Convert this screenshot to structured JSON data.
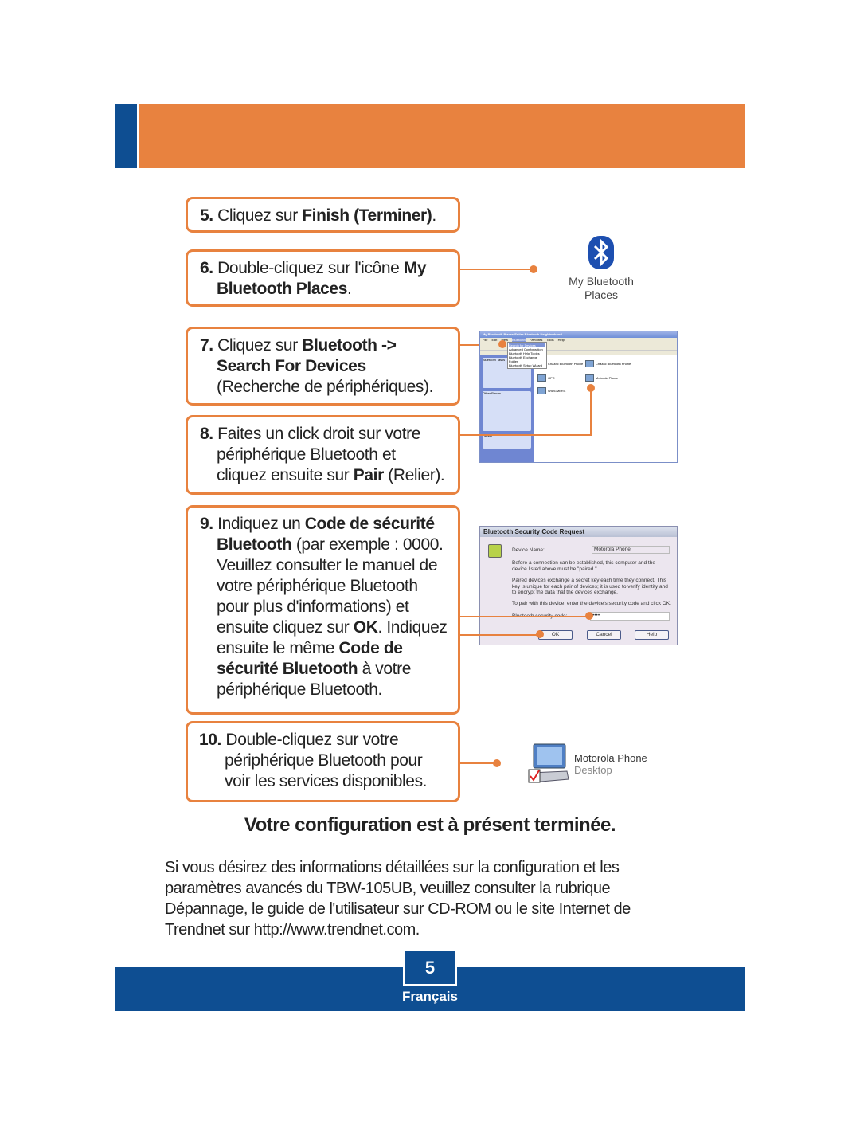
{
  "colors": {
    "accent": "#E8823F",
    "brand": "#0E4E92"
  },
  "steps": [
    {
      "num": "5.",
      "segments": [
        {
          "t": " Cliquez sur "
        },
        {
          "t": "Finish (Terminer)",
          "b": true
        },
        {
          "t": "."
        }
      ]
    },
    {
      "num": "6.",
      "segments": [
        {
          "t": " Double-cliquez sur l'icône "
        },
        {
          "t": "My Bluetooth Places",
          "b": true
        },
        {
          "t": "."
        }
      ]
    },
    {
      "num": "7.",
      "segments": [
        {
          "t": " Cliquez sur "
        },
        {
          "t": "Bluetooth -> Search For Devices",
          "b": true
        },
        {
          "t": " (Recherche de périphériques)."
        }
      ]
    },
    {
      "num": "8.",
      "segments": [
        {
          "t": " Faites un click droit sur votre périphérique Bluetooth et cliquez ensuite sur "
        },
        {
          "t": "Pair",
          "b": true
        },
        {
          "t": " (Relier)."
        }
      ]
    },
    {
      "num": "9.",
      "segments": [
        {
          "t": " Indiquez un "
        },
        {
          "t": "Code de sécurité Bluetooth",
          "b": true
        },
        {
          "t": " (par exemple : 0000. Veuillez consulter le manuel de votre périphérique Bluetooth pour plus d'informations) et ensuite cliquez sur "
        },
        {
          "t": "OK",
          "b": true
        },
        {
          "t": ". Indiquez ensuite le même "
        },
        {
          "t": "Code de sécurité Bluetooth",
          "b": true
        },
        {
          "t": " à votre périphérique Bluetooth."
        }
      ]
    },
    {
      "num": "10.",
      "segments": [
        {
          "t": " Double-cliquez sur votre périphérique Bluetooth pour voir les services disponibles."
        }
      ]
    }
  ],
  "bluetooth_icon": {
    "icon": "bluetooth-icon",
    "label": "My Bluetooth Places"
  },
  "explorer": {
    "title": "My Bluetooth Places\\Entire Bluetooth Neighborhood",
    "menu": [
      "File",
      "Edit",
      "View",
      "Bluetooth",
      "Favorites",
      "Tools",
      "Help"
    ],
    "dropdown": [
      "Search for Devices",
      "Advanced Configuration",
      "Bluetooth Help Topics",
      "Bluetooth Exchange Folder",
      "Bluetooth Setup Wizard"
    ],
    "devices": [
      "Chaz8c Bluetooth Phone",
      "Chaz8c Bluetooth Phone",
      "GPC",
      "Motorola Phone",
      "WIDGMERX"
    ],
    "side_panels": [
      "Bluetooth Tasks",
      "Other Places",
      "Details"
    ]
  },
  "dialog": {
    "title": "Bluetooth Security Code Request",
    "device_name_label": "Device Name:",
    "device_name": "Motorola Phone",
    "p1": "Before a connection can be established, this computer and the device listed above must be \"paired.\"",
    "p2": "Paired devices exchange a secret key each time they connect. This key is unique for each pair of devices; it is used to verify identity and to encrypt the data that the devices exchange.",
    "p3": "To pair with this device, enter the device's security code and click OK.",
    "code_label": "Bluetooth security code:",
    "code_value": "••••",
    "ok": "OK",
    "cancel": "Cancel",
    "help": "Help"
  },
  "device": {
    "name": "Motorola Phone",
    "type": "Desktop"
  },
  "final_title": "Votre configuration est à présent terminée.",
  "info": "Si vous désirez des informations détaillées sur la configuration et les paramètres avancés du TBW-105UB, veuillez consulter la rubrique Dépannage, le guide de l'utilisateur sur CD-ROM ou le site Internet de Trendnet sur http://www.trendnet.com.",
  "footer": {
    "page": "5",
    "language": "Français"
  }
}
